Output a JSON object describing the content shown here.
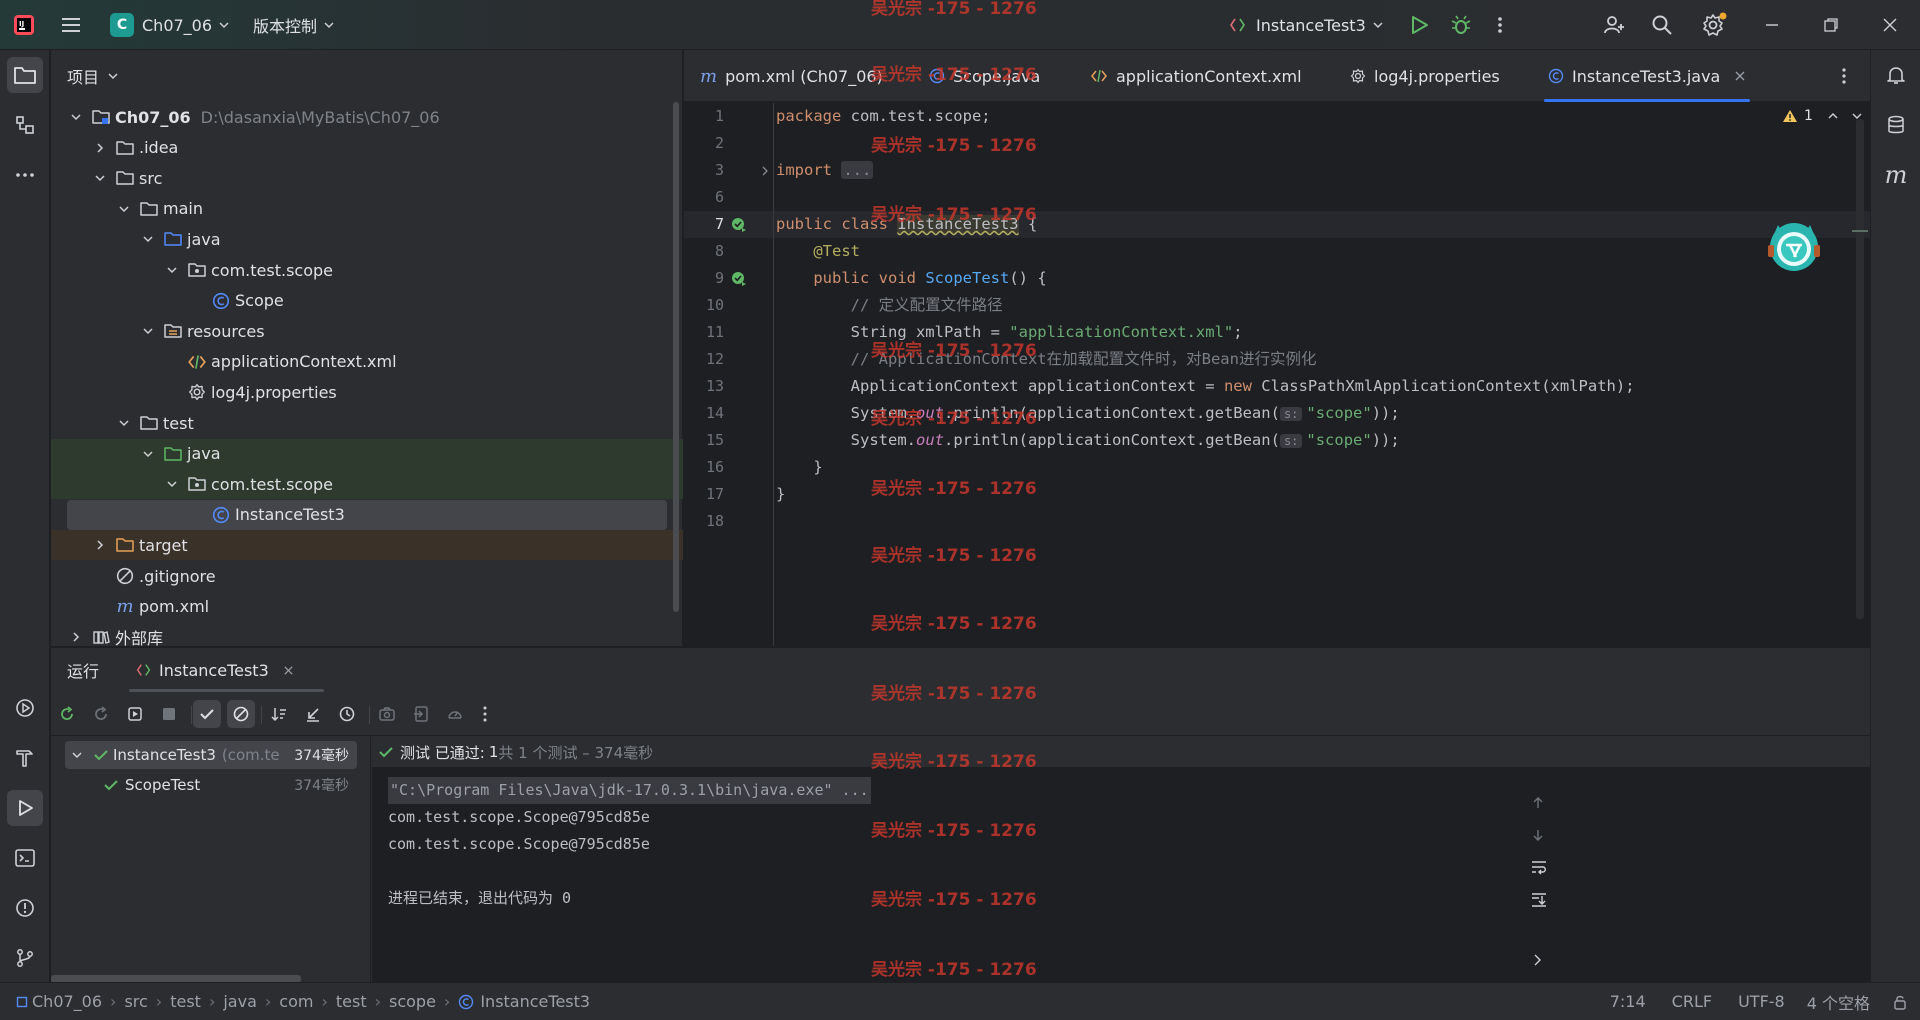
{
  "titlebar": {
    "project_letter": "C",
    "project_name": "Ch07_06",
    "vcs_label": "版本控制",
    "run_config": "InstanceTest3"
  },
  "project_panel": {
    "title": "项目",
    "tree": [
      {
        "label": "Ch07_06",
        "hint": "D:\\dasanxia\\MyBatis\\Ch07_06",
        "icon": "module-folder-icon",
        "expanded": true
      },
      {
        "label": ".idea",
        "icon": "folder-icon",
        "expanded": false
      },
      {
        "label": "src",
        "icon": "folder-icon",
        "expanded": true
      },
      {
        "label": "main",
        "icon": "folder-icon",
        "expanded": true
      },
      {
        "label": "java",
        "icon": "source-folder-icon",
        "expanded": true
      },
      {
        "label": "com.test.scope",
        "icon": "package-icon",
        "expanded": true
      },
      {
        "label": "Scope",
        "icon": "class-icon"
      },
      {
        "label": "resources",
        "icon": "resources-folder-icon",
        "expanded": true
      },
      {
        "label": "applicationContext.xml",
        "icon": "xml-file-icon"
      },
      {
        "label": "log4j.properties",
        "icon": "properties-file-icon"
      },
      {
        "label": "test",
        "icon": "folder-icon",
        "expanded": true
      },
      {
        "label": "java",
        "icon": "test-source-folder-icon",
        "expanded": true
      },
      {
        "label": "com.test.scope",
        "icon": "package-icon",
        "expanded": true
      },
      {
        "label": "InstanceTest3",
        "icon": "class-icon"
      },
      {
        "label": "target",
        "icon": "excluded-folder-icon",
        "expanded": false
      },
      {
        "label": ".gitignore",
        "icon": "ignore-file-icon"
      },
      {
        "label": "pom.xml",
        "icon": "maven-file-icon"
      },
      {
        "label": "外部库",
        "icon": "library-icon",
        "expanded": false
      }
    ]
  },
  "editor": {
    "tabs": [
      {
        "label": "pom.xml (Ch07_06)",
        "icon": "maven-file-icon"
      },
      {
        "label": "Scope.java",
        "icon": "class-icon"
      },
      {
        "label": "applicationContext.xml",
        "icon": "xml-file-icon"
      },
      {
        "label": "log4j.properties",
        "icon": "properties-file-icon"
      },
      {
        "label": "InstanceTest3.java",
        "icon": "class-icon",
        "active": true
      }
    ],
    "warning_count": "1",
    "line_numbers": [
      "1",
      "2",
      "3",
      "6",
      "7",
      "8",
      "9",
      "10",
      "11",
      "12",
      "13",
      "14",
      "15",
      "16",
      "17",
      "18"
    ],
    "code": {
      "l1_kw": "package",
      "l1_rest": " com.test.scope;",
      "l3_kw": "import",
      "l3_fold": "...",
      "l7_kw": "public class",
      "l7_cls": "InstanceTest3",
      "l7_rest": " {",
      "l8_ann": "@Test",
      "l9_kw": "public void",
      "l9_fn": "ScopeTest",
      "l9_rest": "() {",
      "l10_cmt": "// 定义配置文件路径",
      "l11_a": "String xmlPath = ",
      "l11_str": "\"applicationContext.xml\"",
      "l11_b": ";",
      "l12_cmt": "// ApplicationContext在加载配置文件时，对Bean进行实例化",
      "l13_a": "ApplicationContext applicationContext = ",
      "l13_kw": "new",
      "l13_b": " ClassPathXmlApplicationContext(xmlPath);",
      "l14_a": "System.",
      "l14_it": "out",
      "l14_b": ".println(applicationContext.getBean(",
      "l14_hint": "s:",
      "l14_str": "\"scope\"",
      "l14_c": "));",
      "l15_a": "System.",
      "l15_it": "out",
      "l15_b": ".println(applicationContext.getBean(",
      "l15_hint": "s:",
      "l15_str": "\"scope\"",
      "l15_c": "));",
      "l16": "}",
      "l17": "}"
    }
  },
  "run_panel": {
    "title": "运行",
    "tab": "InstanceTest3",
    "status_prefix": "测试 已通过:",
    "status_count": "1",
    "status_detail": "共 1 个测试 – 374毫秒",
    "tests": [
      {
        "name": "InstanceTest3",
        "hint": "(com.te",
        "time": "374毫秒"
      },
      {
        "name": "ScopeTest",
        "time": "374毫秒"
      }
    ],
    "console": [
      "\"C:\\Program Files\\Java\\jdk-17.0.3.1\\bin\\java.exe\" ...",
      "com.test.scope.Scope@795cd85e",
      "com.test.scope.Scope@795cd85e",
      "",
      "进程已结束，退出代码为 0"
    ]
  },
  "statusbar": {
    "breadcrumbs": [
      "Ch07_06",
      "src",
      "test",
      "java",
      "com",
      "test",
      "scope",
      "InstanceTest3"
    ],
    "position": "7:14",
    "line_sep": "CRLF",
    "encoding": "UTF-8",
    "indent": "4 个空格"
  },
  "watermark": "吴光宗 -175 - 1276",
  "colors": {
    "accent": "#3574f0",
    "success": "#5fb865",
    "watermark": "#c9372c"
  }
}
